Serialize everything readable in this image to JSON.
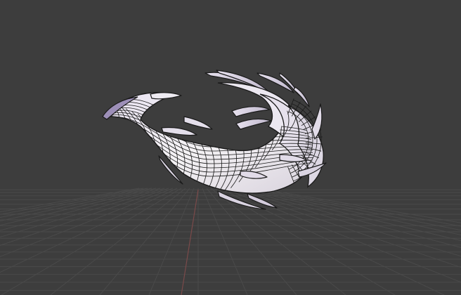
{
  "viewport": {
    "background_color": "#3d3d3d",
    "grid_color": "#4a4a4a",
    "x_axis_color": "#7a4a4a",
    "mesh_fill_light": "#f1eef4",
    "mesh_fill_shade": "#cdc7d6",
    "mesh_fill_deep": "#aaa3b5",
    "wire_color": "#1a1a1a",
    "object": "tail-mesh",
    "display_mode": "wireframe-overlay"
  }
}
